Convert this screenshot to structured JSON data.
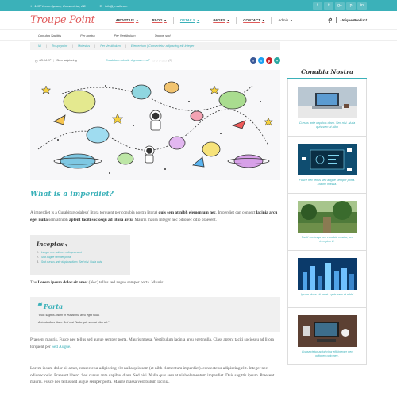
{
  "topbar": {
    "address": "1037 Lorem Ipsum, Consectetur, AB",
    "email": "info@ymail.com",
    "address_icon": "map-pin-icon",
    "email_icon": "envelope-icon",
    "socials": [
      "f",
      "t",
      "g+",
      "p",
      "in"
    ]
  },
  "header": {
    "logo": "Troupe Point",
    "nav": [
      {
        "label": "ABOUT US",
        "caret": "▼",
        "active": false
      },
      {
        "label": "BLOG",
        "caret": "▼",
        "active": false
      },
      {
        "label": "DETAILS",
        "caret": "▼",
        "active": true
      },
      {
        "label": "PAGES",
        "caret": "▼",
        "active": false
      },
      {
        "label": "CONTACT",
        "caret": "▼",
        "active": false
      }
    ],
    "admin": "Admin",
    "admin_caret": "▼",
    "product": "Unique Product"
  },
  "subnav": [
    "Conubia Sagittis",
    "Per nostra",
    "Per Vestibulum",
    "Troupe sed"
  ],
  "breadcrumb": [
    "Mi",
    "Troupepoint",
    "Molestus",
    "Per Vestibulum",
    "Elementum | Consectetur adipiscing elit Integer"
  ],
  "meta": {
    "date": "08.04.17",
    "category": "Sem adipiscing",
    "rating_label": "Curabitur molestie dignissim est?",
    "stars": "☆☆☆☆☆",
    "count": "(0)",
    "shares": [
      {
        "icon": "f",
        "color": "#3b5998"
      },
      {
        "icon": "t",
        "color": "#1da1f2"
      },
      {
        "icon": "p",
        "color": "#cb2027"
      },
      {
        "icon": "+",
        "color": "#2aa7a0"
      }
    ]
  },
  "article": {
    "heading": "What is a imperdiet?",
    "p1": {
      "t1": "A imperdiet is a Curabitursodales ( litora torquent per conubia nostra litora) ",
      "b1": "quis sem at nibh elementum nec",
      "t2": ". Imperdiet can connect ",
      "b2": "lacinia arcu eget nulla",
      "t3": " sem at nibh ",
      "b3": "aptent taciti sociosqu ad litora arcu.",
      "t4": " Mauris massa Integer nec odionec odio praesent."
    },
    "toc": {
      "title": "Inceptos",
      "caret": "▼",
      "items": [
        "Integer nec odionec odio praesent",
        "Sed augue semper porta",
        "Sed cursus ante dapibus diam. Sed nisi. Nulla quis"
      ]
    },
    "p2": {
      "t1": "The ",
      "b1": "Lorem ipsum dolor sit amet",
      "t2": " (Nec) tellus sed augue semper porta. Mauris:"
    },
    "quote": {
      "title": "Porta",
      "icon": "❝",
      "lines": [
        "\"Duis sagittis ipsum in est lacinia arcu eget nulla.",
        "Ante dapibus diam. Sed nisi. Nulla quis sem at nibh ad.\""
      ]
    },
    "p3": {
      "text": "Praesent mauris. Fusce nec tellus sed augue semper porta. Mauris massa. Vestibulum lacinia arcu eget nulla. Class aptent taciti sociosqu ad litora torquent per ",
      "link": "Sed Augue",
      "end": "."
    },
    "p4": "Lorem ipsum dolor sit amet, consectetur adipiscing elit nulla quis sem (at nibh elementum imperdiet). consectetur adipiscing elit. Integer nec odionec odio. Praesent libero. Sed cursus ante dapibus diam. Sed nisi. Nulla quis sem at nibh elementum imperdiet. Duis sagittis ipsum. Praesent mauris. Fusce nec tellus sed augue semper porta. Mauris massa vestibulum lacinia."
  },
  "sidebar": {
    "title": "Conubia Nostra",
    "cards": [
      {
        "caption": "Cursus ante dapibus diam. Sed nisi. Nulla quis sem at nibh",
        "image": "laptop-desk"
      },
      {
        "caption": "Fusce nec tellus sed augue semper porta. Mauris massa.",
        "image": "blue-dashboard"
      },
      {
        "caption": "Taciti sociosqu per conubia nostra, per inceptos C.",
        "image": "green-forest"
      },
      {
        "caption": "Ipsum dolor sit amet - quis sem at nibh!",
        "image": "city-graphs"
      },
      {
        "caption": "Consectetur adipiscing elit Integer nec odionec odio nec.",
        "image": "workspace-top"
      }
    ]
  }
}
